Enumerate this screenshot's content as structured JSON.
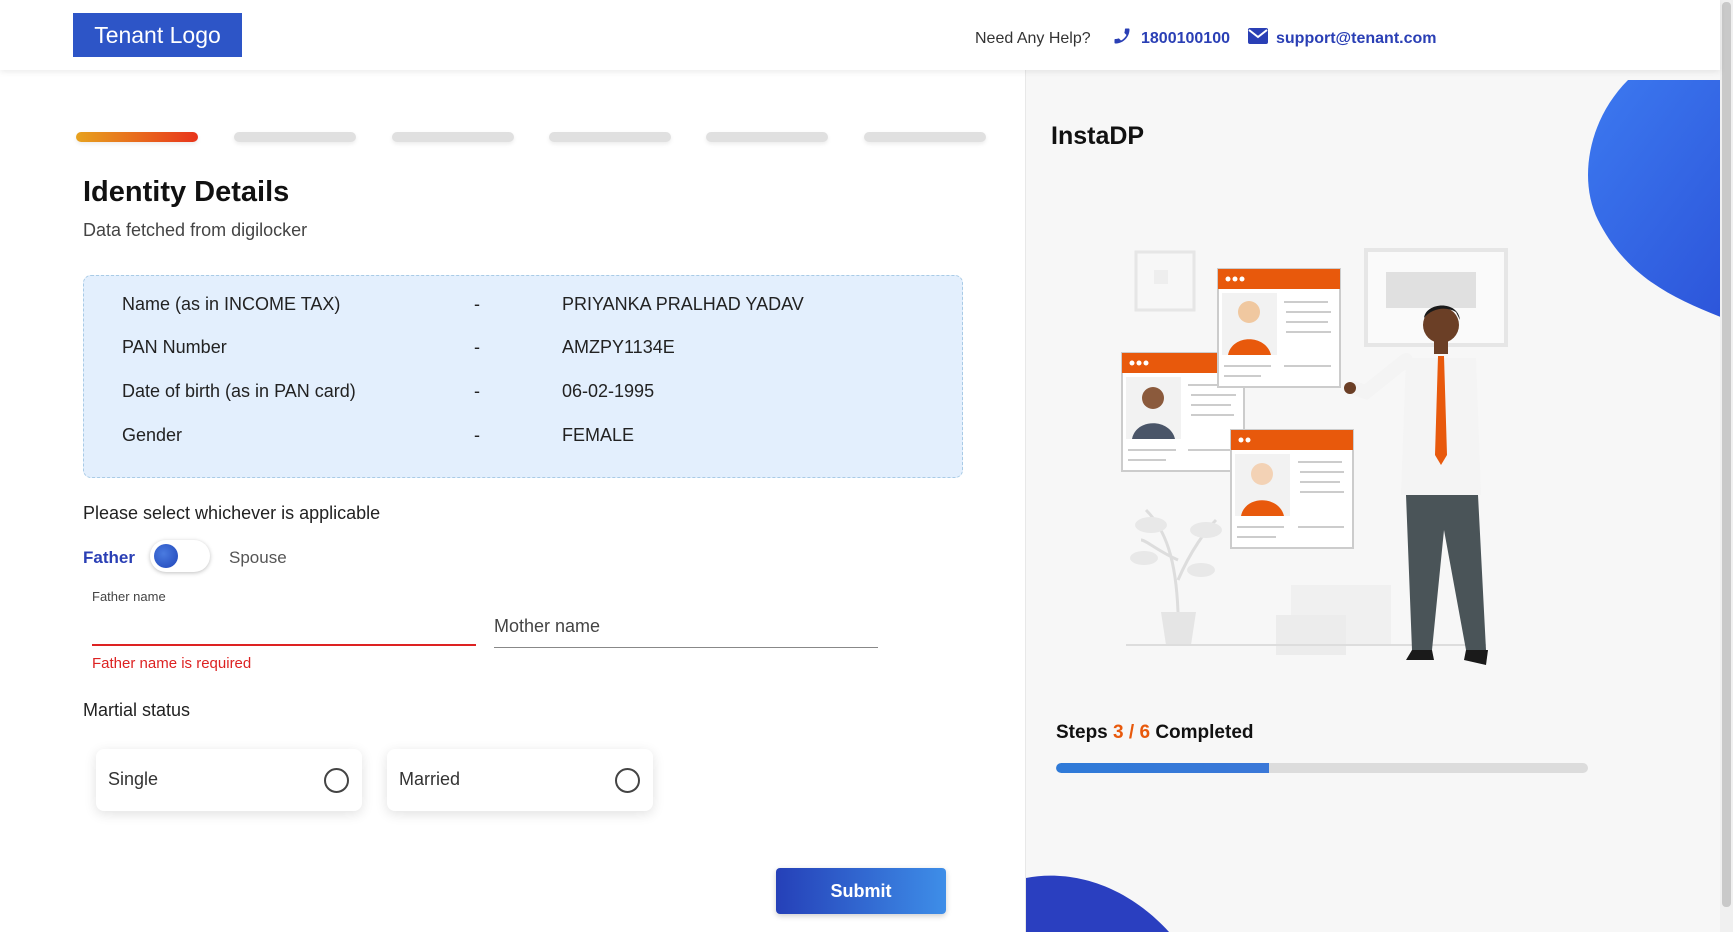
{
  "header": {
    "logo_text": "Tenant Logo",
    "help_text": "Need Any Help?",
    "phone": "1800100100",
    "email": "support@tenant.com"
  },
  "steps_bar": {
    "total": 6,
    "active_index": 0
  },
  "main": {
    "title": "Identity Details",
    "subtitle": "Data fetched from digilocker",
    "info_rows": [
      {
        "label": "Name (as in INCOME TAX)",
        "sep": "-",
        "value": "PRIYANKA PRALHAD YADAV"
      },
      {
        "label": "PAN Number",
        "sep": "-",
        "value": "AMZPY1134E"
      },
      {
        "label": "Date of birth (as in PAN card)",
        "sep": "-",
        "value": "06-02-1995"
      },
      {
        "label": "Gender",
        "sep": "-",
        "value": "FEMALE"
      }
    ],
    "select_label": "Please select whichever is applicable",
    "toggle": {
      "left_label": "Father",
      "right_label": "Spouse",
      "selected": "Father"
    },
    "father_name": {
      "small_label": "Father name",
      "value": "",
      "error": "Father name is required"
    },
    "mother_name": {
      "placeholder": "Mother name",
      "value": ""
    },
    "marital": {
      "label": "Martial status",
      "options": [
        "Single",
        "Married"
      ]
    },
    "submit_label": "Submit"
  },
  "right_panel": {
    "title": "InstaDP",
    "steps_prefix": "Steps",
    "steps_current": "3",
    "steps_sep": "/",
    "steps_total": "6",
    "steps_suffix": "Completed",
    "progress_fraction": 0.4
  },
  "colors": {
    "brand_blue": "#2d55c7",
    "link_blue": "#2a3fb5",
    "accent_orange": "#e8590c",
    "error_red": "#dd2222",
    "info_bg": "#e3effd"
  }
}
